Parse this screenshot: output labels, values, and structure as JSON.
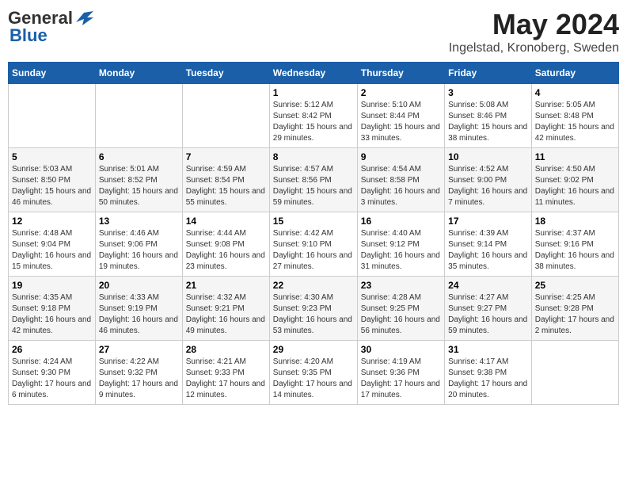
{
  "header": {
    "logo_general": "General",
    "logo_blue": "Blue",
    "month_title": "May 2024",
    "location": "Ingelstad, Kronoberg, Sweden"
  },
  "weekdays": [
    "Sunday",
    "Monday",
    "Tuesday",
    "Wednesday",
    "Thursday",
    "Friday",
    "Saturday"
  ],
  "weeks": [
    [
      {
        "day": "",
        "info": ""
      },
      {
        "day": "",
        "info": ""
      },
      {
        "day": "",
        "info": ""
      },
      {
        "day": "1",
        "info": "Sunrise: 5:12 AM\nSunset: 8:42 PM\nDaylight: 15 hours\nand 29 minutes."
      },
      {
        "day": "2",
        "info": "Sunrise: 5:10 AM\nSunset: 8:44 PM\nDaylight: 15 hours\nand 33 minutes."
      },
      {
        "day": "3",
        "info": "Sunrise: 5:08 AM\nSunset: 8:46 PM\nDaylight: 15 hours\nand 38 minutes."
      },
      {
        "day": "4",
        "info": "Sunrise: 5:05 AM\nSunset: 8:48 PM\nDaylight: 15 hours\nand 42 minutes."
      }
    ],
    [
      {
        "day": "5",
        "info": "Sunrise: 5:03 AM\nSunset: 8:50 PM\nDaylight: 15 hours\nand 46 minutes."
      },
      {
        "day": "6",
        "info": "Sunrise: 5:01 AM\nSunset: 8:52 PM\nDaylight: 15 hours\nand 50 minutes."
      },
      {
        "day": "7",
        "info": "Sunrise: 4:59 AM\nSunset: 8:54 PM\nDaylight: 15 hours\nand 55 minutes."
      },
      {
        "day": "8",
        "info": "Sunrise: 4:57 AM\nSunset: 8:56 PM\nDaylight: 15 hours\nand 59 minutes."
      },
      {
        "day": "9",
        "info": "Sunrise: 4:54 AM\nSunset: 8:58 PM\nDaylight: 16 hours\nand 3 minutes."
      },
      {
        "day": "10",
        "info": "Sunrise: 4:52 AM\nSunset: 9:00 PM\nDaylight: 16 hours\nand 7 minutes."
      },
      {
        "day": "11",
        "info": "Sunrise: 4:50 AM\nSunset: 9:02 PM\nDaylight: 16 hours\nand 11 minutes."
      }
    ],
    [
      {
        "day": "12",
        "info": "Sunrise: 4:48 AM\nSunset: 9:04 PM\nDaylight: 16 hours\nand 15 minutes."
      },
      {
        "day": "13",
        "info": "Sunrise: 4:46 AM\nSunset: 9:06 PM\nDaylight: 16 hours\nand 19 minutes."
      },
      {
        "day": "14",
        "info": "Sunrise: 4:44 AM\nSunset: 9:08 PM\nDaylight: 16 hours\nand 23 minutes."
      },
      {
        "day": "15",
        "info": "Sunrise: 4:42 AM\nSunset: 9:10 PM\nDaylight: 16 hours\nand 27 minutes."
      },
      {
        "day": "16",
        "info": "Sunrise: 4:40 AM\nSunset: 9:12 PM\nDaylight: 16 hours\nand 31 minutes."
      },
      {
        "day": "17",
        "info": "Sunrise: 4:39 AM\nSunset: 9:14 PM\nDaylight: 16 hours\nand 35 minutes."
      },
      {
        "day": "18",
        "info": "Sunrise: 4:37 AM\nSunset: 9:16 PM\nDaylight: 16 hours\nand 38 minutes."
      }
    ],
    [
      {
        "day": "19",
        "info": "Sunrise: 4:35 AM\nSunset: 9:18 PM\nDaylight: 16 hours\nand 42 minutes."
      },
      {
        "day": "20",
        "info": "Sunrise: 4:33 AM\nSunset: 9:19 PM\nDaylight: 16 hours\nand 46 minutes."
      },
      {
        "day": "21",
        "info": "Sunrise: 4:32 AM\nSunset: 9:21 PM\nDaylight: 16 hours\nand 49 minutes."
      },
      {
        "day": "22",
        "info": "Sunrise: 4:30 AM\nSunset: 9:23 PM\nDaylight: 16 hours\nand 53 minutes."
      },
      {
        "day": "23",
        "info": "Sunrise: 4:28 AM\nSunset: 9:25 PM\nDaylight: 16 hours\nand 56 minutes."
      },
      {
        "day": "24",
        "info": "Sunrise: 4:27 AM\nSunset: 9:27 PM\nDaylight: 16 hours\nand 59 minutes."
      },
      {
        "day": "25",
        "info": "Sunrise: 4:25 AM\nSunset: 9:28 PM\nDaylight: 17 hours\nand 2 minutes."
      }
    ],
    [
      {
        "day": "26",
        "info": "Sunrise: 4:24 AM\nSunset: 9:30 PM\nDaylight: 17 hours\nand 6 minutes."
      },
      {
        "day": "27",
        "info": "Sunrise: 4:22 AM\nSunset: 9:32 PM\nDaylight: 17 hours\nand 9 minutes."
      },
      {
        "day": "28",
        "info": "Sunrise: 4:21 AM\nSunset: 9:33 PM\nDaylight: 17 hours\nand 12 minutes."
      },
      {
        "day": "29",
        "info": "Sunrise: 4:20 AM\nSunset: 9:35 PM\nDaylight: 17 hours\nand 14 minutes."
      },
      {
        "day": "30",
        "info": "Sunrise: 4:19 AM\nSunset: 9:36 PM\nDaylight: 17 hours\nand 17 minutes."
      },
      {
        "day": "31",
        "info": "Sunrise: 4:17 AM\nSunset: 9:38 PM\nDaylight: 17 hours\nand 20 minutes."
      },
      {
        "day": "",
        "info": ""
      }
    ]
  ]
}
